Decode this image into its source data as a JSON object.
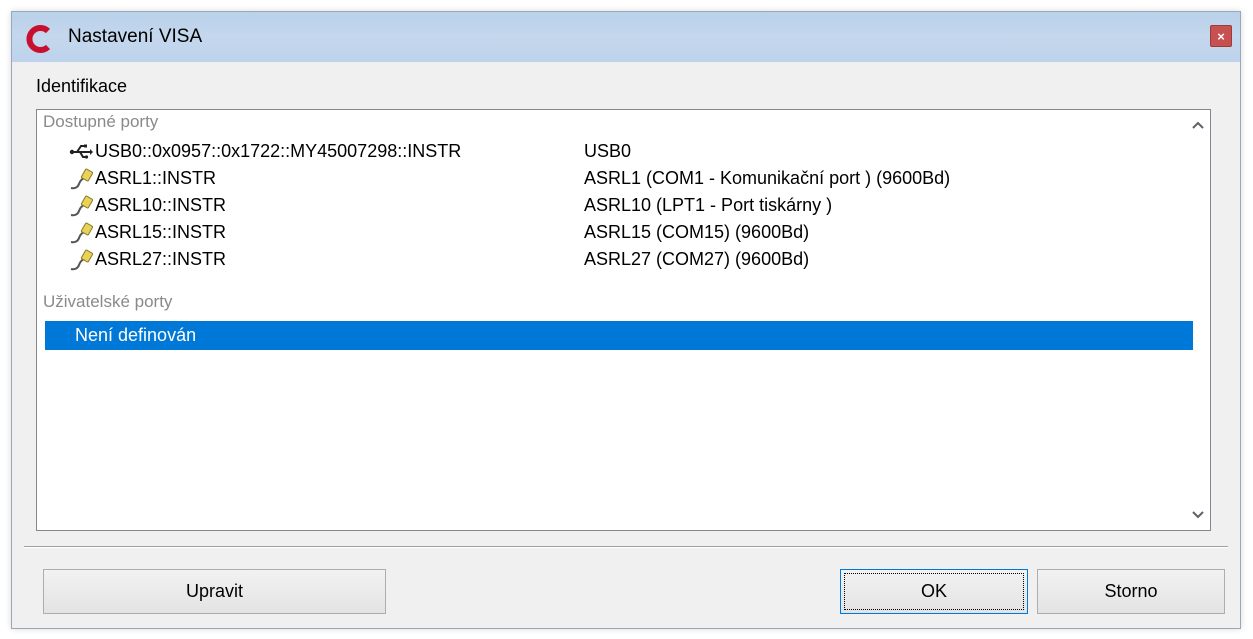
{
  "window": {
    "title": "Nastavení VISA",
    "close_glyph": "×"
  },
  "group": {
    "label": "Identifikace"
  },
  "list": {
    "available_header": "Dostupné porty",
    "available_ports": [
      {
        "icon": "usb-icon",
        "name": "USB0::0x0957::0x1722::MY45007298::INSTR",
        "description": "USB0"
      },
      {
        "icon": "serial-cable-icon",
        "name": "ASRL1::INSTR",
        "description": "ASRL1  (COM1 - Komunikační port ) (9600Bd)"
      },
      {
        "icon": "serial-cable-icon",
        "name": "ASRL10::INSTR",
        "description": "ASRL10  (LPT1 - Port tiskárny )"
      },
      {
        "icon": "serial-cable-icon",
        "name": "ASRL15::INSTR",
        "description": "ASRL15  (COM15) (9600Bd)"
      },
      {
        "icon": "serial-cable-icon",
        "name": "ASRL27::INSTR",
        "description": "ASRL27  (COM27) (9600Bd)"
      }
    ],
    "user_header": "Uživatelské porty",
    "user_selected_item": "Není definován"
  },
  "buttons": {
    "edit_label": "Upravit",
    "ok_label": "OK",
    "cancel_label": "Storno"
  },
  "colors": {
    "selection": "#0078d7",
    "close_button": "#c75050",
    "titlebar": "#bdd3ec"
  }
}
